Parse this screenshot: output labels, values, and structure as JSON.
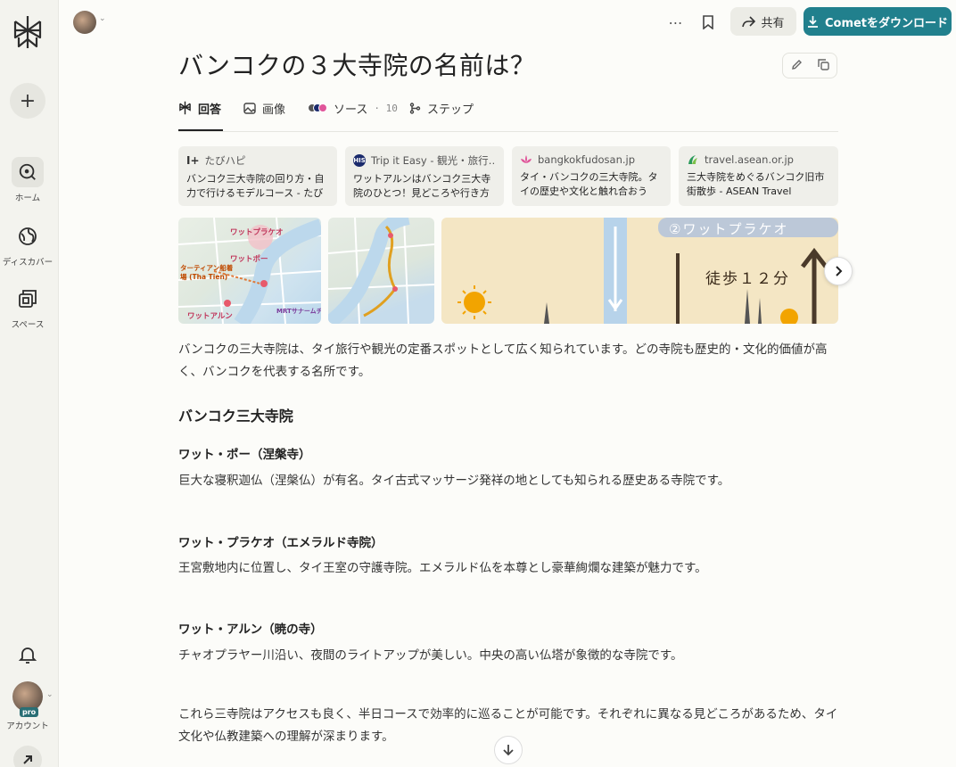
{
  "sidebar": {
    "new_label": "+",
    "items": [
      {
        "label": "ホーム"
      },
      {
        "label": "ディスカバー"
      },
      {
        "label": "スペース"
      }
    ],
    "account_label": "アカウント",
    "pro_badge": "pro"
  },
  "toolbar": {
    "more_label": "⋯",
    "share_label": "共有",
    "download_label": "Cometをダウンロード"
  },
  "question": {
    "title": "バンコクの３大寺院の名前は？"
  },
  "tabs": [
    {
      "label": "回答"
    },
    {
      "label": "画像"
    },
    {
      "label": "ソース",
      "count": "10"
    },
    {
      "label": "ステップ"
    }
  ],
  "sources": [
    {
      "site": "たびハピ",
      "title": "バンコク三大寺院の回り方・自力で行けるモデルコース - たびハピ",
      "fav_color": "#555555"
    },
    {
      "site": "Trip it Easy - 観光・旅行…",
      "title": "ワットアルンはバンコク三大寺院のひとつ！見どころや行き方 …",
      "fav_color": "#1a2a6c"
    },
    {
      "site": "bangkokfudosan.jp",
      "title": "タイ・バンコクの三大寺院。タイの歴史や文化と触れ合おう",
      "fav_color": "#e0559a"
    },
    {
      "site": "travel.asean.or.jp",
      "title": "三大寺院をめぐるバンコク旧市街散歩 - ASEAN Travel",
      "fav_color": "#2a9a5a"
    }
  ],
  "images": {
    "map1_labels": [
      "ワットプラケオ",
      "ワットポー",
      "ターティアン船着場 (Tha Tien)",
      "MRTサナームチャイ",
      "ワットアルン"
    ],
    "banner_text": "徒歩１２分",
    "banner_header": "②ワットプラケオ"
  },
  "answer": {
    "intro": "バンコクの三大寺院は、タイ旅行や観光の定番スポットとして広く知られています。どの寺院も歴史的・文化的価値が高く、バンコクを代表する名所です。",
    "section_heading": "バンコク三大寺院",
    "temples": [
      {
        "name": "ワット・ポー（涅槃寺）",
        "desc": "巨大な寝釈迦仏（涅槃仏）が有名。タイ古式マッサージ発祥の地としても知られる歴史ある寺院です。"
      },
      {
        "name": "ワット・プラケオ（エメラルド寺院）",
        "desc": "王宮敷地内に位置し、タイ王室の守護寺院。エメラルド仏を本尊とし豪華絢爛な建築が魅力です。"
      },
      {
        "name": "ワット・アルン（暁の寺）",
        "desc": "チャオプラヤー川沿い、夜間のライトアップが美しい。中央の高い仏塔が象徴的な寺院です。"
      }
    ],
    "conclusion": "これら三寺院はアクセスも良く、半日コースで効率的に巡ることが可能です。それぞれに異なる見どころがあるため、タイ文化や仏教建築への理解が深まります。"
  },
  "colors": {
    "accent": "#21808d",
    "sidebar_bg": "#f3f3ee",
    "page_bg": "#fcfcf9"
  }
}
